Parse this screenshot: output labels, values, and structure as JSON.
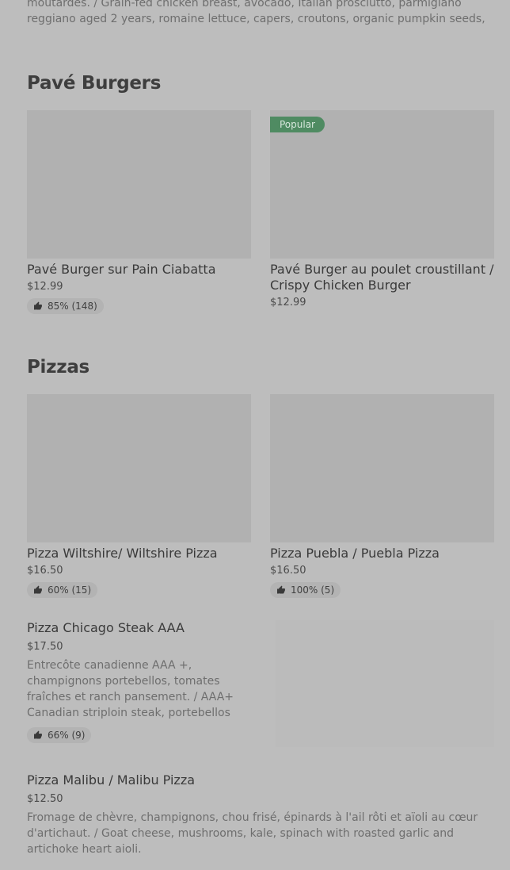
{
  "top_description": "moutardes. / Grain-fed chicken breast, avocado, Italian prosciutto, parmigiano reggiano aged 2 years, romaine lettuce, capers, croutons, organic pumpkin seeds, Caesar vinaigret...",
  "sections": [
    {
      "title": "Pavé Burgers",
      "items": [
        {
          "name": "Pavé Burger sur Pain Ciabatta",
          "price": "$12.99",
          "rating": "85% (148)"
        },
        {
          "name": "Pavé Burger au poulet croustillant / Crispy Chicken Burger",
          "price": "$12.99",
          "badge": "Popular"
        }
      ]
    },
    {
      "title": "Pizzas",
      "items": [
        {
          "name": "Pizza Wiltshire/ Wiltshire Pizza",
          "price": "$16.50",
          "rating": "60% (15)"
        },
        {
          "name": "Pizza Puebla / Puebla Pizza",
          "price": "$16.50",
          "rating": "100% (5)"
        }
      ],
      "list_items": [
        {
          "name": "Pizza Chicago Steak AAA",
          "price": "$17.50",
          "description": "Entrecôte canadienne AAA +, champignons portebellos, tomates fraîches et ranch pansement. / AAA+ Canadian striploin steak, portebellos mushrooms, fresh tomatoes and...",
          "rating": "66% (9)"
        },
        {
          "name": "Pizza Malibu / Malibu Pizza",
          "price": "$12.50",
          "description": "Fromage de chèvre, champignons, chou frisé, épinards à l'ail rôti et aïoli au cœur d'artichaut. / Goat cheese, mushrooms, kale, spinach with roasted garlic and artichoke heart aioli."
        }
      ]
    }
  ],
  "icons": {
    "rating": "thumbs-up-icon"
  },
  "colors": {
    "popular_badge": "#4f8b62",
    "background": "#bdbdbd",
    "image_placeholder": "#b1b1b1"
  }
}
